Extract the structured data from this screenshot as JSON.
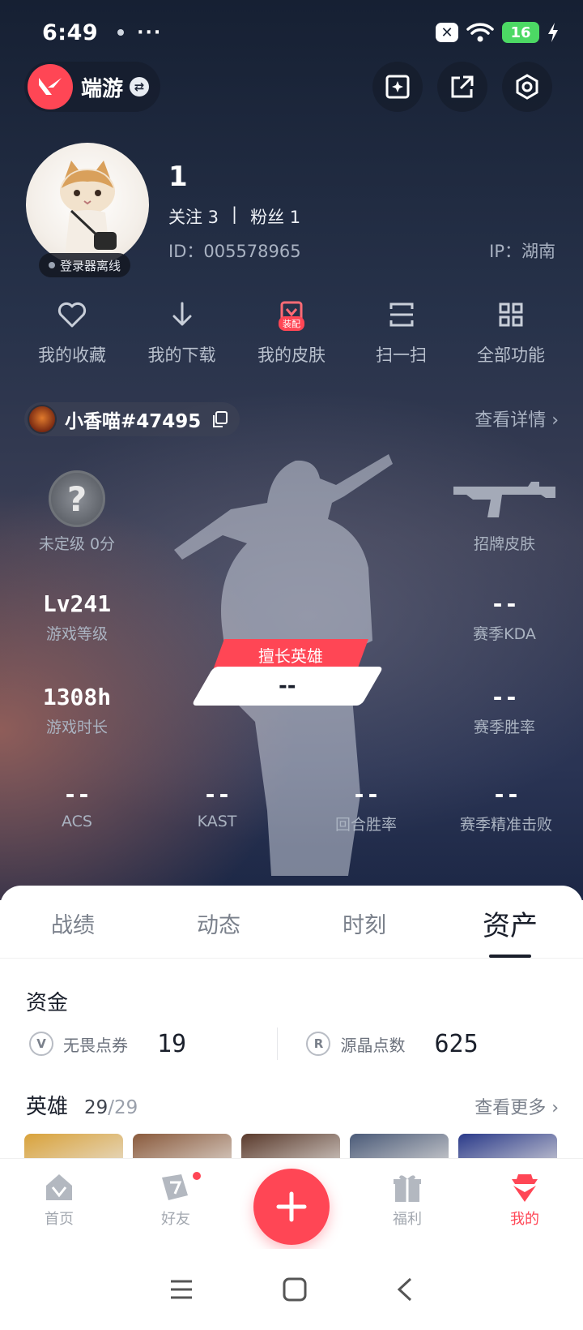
{
  "status_bar": {
    "time": "6:49",
    "more": "···",
    "battery": "16"
  },
  "top_bar": {
    "game_name": "端游"
  },
  "profile": {
    "username": "1",
    "follow_label": "关注 3",
    "separator": "|",
    "fans_label": "粉丝 1",
    "id_text": "ID：005578965",
    "ip_text": "IP：湖南",
    "offline_label": "登录器离线"
  },
  "actions": [
    {
      "label": "我的收藏",
      "icon": "heart-icon"
    },
    {
      "label": "我的下载",
      "icon": "download-icon"
    },
    {
      "label": "我的皮肤",
      "icon": "skin-icon",
      "badge": "装配"
    },
    {
      "label": "扫一扫",
      "icon": "scan-icon"
    },
    {
      "label": "全部功能",
      "icon": "grid-icon"
    }
  ],
  "player": {
    "tag": "小香喵#47495",
    "view_detail": "查看详情 ›"
  },
  "stats": {
    "rank": {
      "icon_text": "?",
      "label": "未定级 0分"
    },
    "skin": {
      "label": "招牌皮肤"
    },
    "level": {
      "value": "Lv241",
      "label": "游戏等级"
    },
    "kda": {
      "value": "--",
      "label": "赛季KDA"
    },
    "hours": {
      "value": "1308h",
      "label": "游戏时长"
    },
    "win_rate": {
      "value": "--",
      "label": "赛季胜率"
    },
    "acs": {
      "value": "--",
      "label": "ACS"
    },
    "kast": {
      "value": "--",
      "label": "KAST"
    },
    "round_win": {
      "value": "--",
      "label": "回合胜率"
    },
    "precise_kill": {
      "value": "--",
      "label": "赛季精准击败"
    },
    "best_hero_tag": "擅长英雄",
    "best_hero_value": "--"
  },
  "tabs": [
    "战绩",
    "动态",
    "时刻",
    "资产"
  ],
  "assets": {
    "funds_title": "资金",
    "vp_label": "无畏点券",
    "vp_value": "19",
    "vp_icon": "V",
    "rp_label": "源晶点数",
    "rp_value": "625",
    "rp_icon": "R",
    "heroes_title": "英雄",
    "heroes_owned": "29",
    "heroes_total": "29",
    "heroes_slash": "/",
    "more_link": "查看更多 ›"
  },
  "hero_card_colors": [
    "#d9a23a",
    "#8a5a3c",
    "#5a3a2c",
    "#4a5a78",
    "#2a3a8a"
  ],
  "bottom_nav": [
    {
      "label": "首页",
      "icon": "home-icon"
    },
    {
      "label": "好友",
      "icon": "friends-icon"
    },
    {
      "label": "福利",
      "icon": "gift-icon"
    },
    {
      "label": "我的",
      "icon": "agent-icon"
    }
  ],
  "colors": {
    "accent": "#ff4655"
  }
}
